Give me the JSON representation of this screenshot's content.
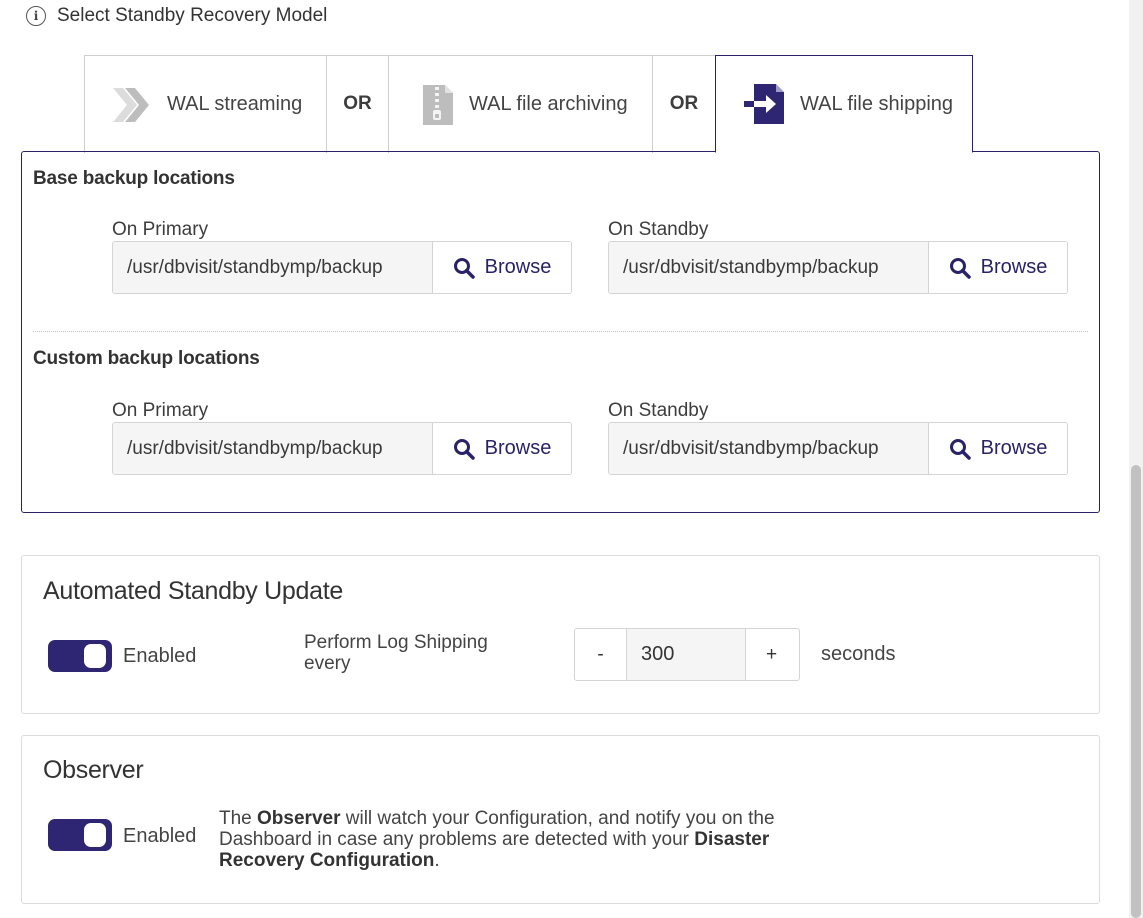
{
  "recovery_model": {
    "title": "Select Standby Recovery Model",
    "info_icon": "info-icon",
    "tabs": [
      {
        "label": "WAL streaming",
        "icon": "double-chevron-right-icon",
        "active": false
      },
      {
        "label": "WAL file archiving",
        "icon": "zip-file-icon",
        "active": false
      },
      {
        "label": "WAL file shipping",
        "icon": "file-import-icon",
        "active": true
      }
    ],
    "or_label": "OR"
  },
  "base_backup": {
    "title": "Base backup locations",
    "primary": {
      "label": "On Primary",
      "value": "/usr/dbvisit/standbymp/backup",
      "button": "Browse"
    },
    "standby": {
      "label": "On Standby",
      "value": "/usr/dbvisit/standbymp/backup",
      "button": "Browse"
    }
  },
  "custom_backup": {
    "title": "Custom backup locations",
    "primary": {
      "label": "On Primary",
      "value": "/usr/dbvisit/standbymp/backup",
      "button": "Browse"
    },
    "standby": {
      "label": "On Standby",
      "value": "/usr/dbvisit/standbymp/backup",
      "button": "Browse"
    }
  },
  "automated_update": {
    "title": "Automated Standby Update",
    "toggle_label": "Enabled",
    "enabled": true,
    "perform_label": "Perform Log Shipping every",
    "decrement": "-",
    "increment": "+",
    "interval": "300",
    "unit": "seconds"
  },
  "observer": {
    "title": "Observer",
    "toggle_label": "Enabled",
    "enabled": true,
    "desc_pre": "The ",
    "desc_bold1": "Observer",
    "desc_mid": " will watch your Configuration, and notify you on the Dashboard in case any problems are detected with your ",
    "desc_bold2": "Disaster Recovery Configuration",
    "desc_post": "."
  },
  "colors": {
    "accent": "#2f2673",
    "active_border": "#2a2266",
    "input_bg": "#f5f5f5",
    "border": "#d4d4d4"
  }
}
